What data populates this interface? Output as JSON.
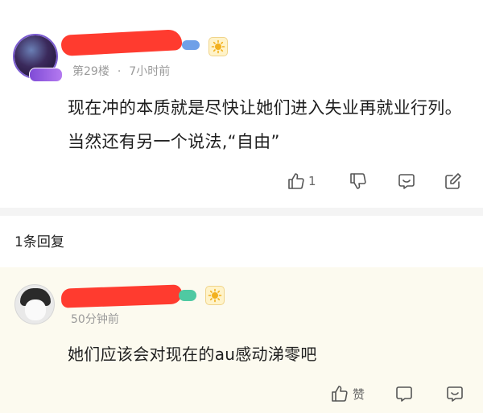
{
  "post": {
    "floor": "第29楼",
    "separator": "·",
    "time": "7小时前",
    "content": "现在冲的本质就是尽快让她们进入失业再就业行列。当然还有另一个说法,“自由”",
    "like_count": "1"
  },
  "replies_header": "1条回复",
  "reply": {
    "time": "50分钟前",
    "content": "她们应该会对现在的au感动涕零吧",
    "like_label": "赞"
  },
  "colors": {
    "redaction": "#ff3b2f",
    "reply_background": "#fcfaef",
    "meta_text": "#9a9a9a"
  },
  "icons": {
    "like": "thumbs-up-icon",
    "dislike": "thumbs-down-icon",
    "comment": "comment-bubble-icon",
    "edit": "edit-pencil-icon",
    "level_badge": "sun-medal-icon"
  }
}
